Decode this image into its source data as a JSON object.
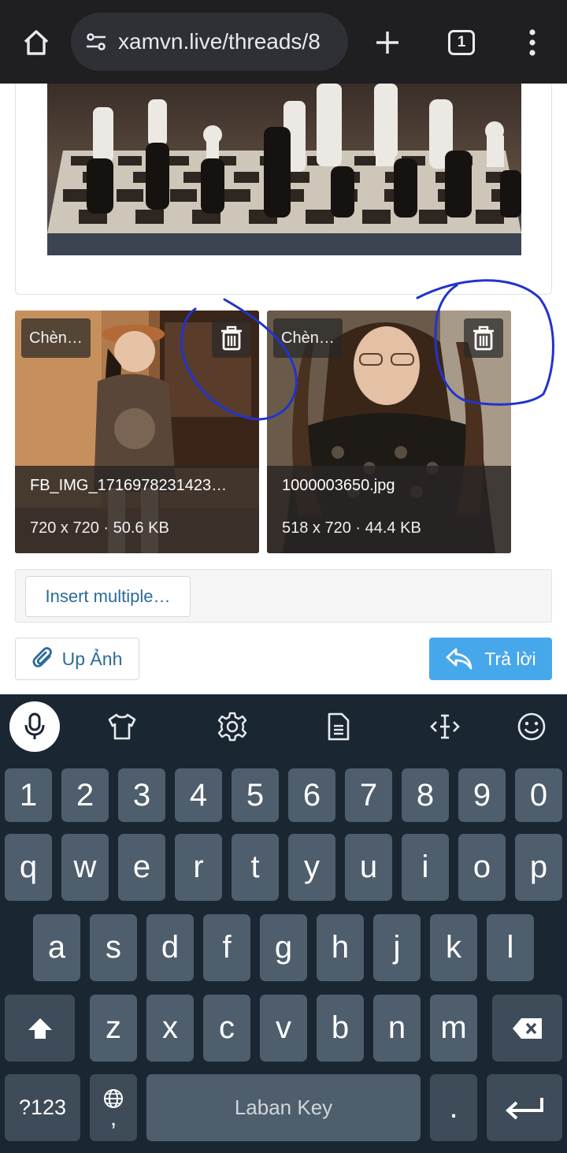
{
  "browser": {
    "url": "xamvn.live/threads/8",
    "tab_count": "1",
    "icons": [
      "home-icon",
      "site-settings-icon",
      "new-tab-plus-icon",
      "tab-switcher-icon",
      "more-vert-icon"
    ]
  },
  "attachments": [
    {
      "insert_label": "Chèn…",
      "filename": "FB_IMG_1716978231423…",
      "meta": "720 x 720 · 50.6 KB"
    },
    {
      "insert_label": "Chèn…",
      "filename": "1000003650.jpg",
      "meta": "518 x 720 · 44.4 KB"
    }
  ],
  "editor": {
    "insert_multiple_label": "Insert multiple…",
    "upload_label": "Up Ảnh",
    "reply_label": "Trả lời"
  },
  "colors": {
    "accent": "#47a7eb",
    "link": "#2a6b98",
    "annotation_circle": "#2233cc",
    "keyboard_bg": "#1b2633",
    "key_bg": "#4f5e6c"
  },
  "keyboard": {
    "toolbar_icons": [
      "mic-icon",
      "theme-shirt-icon",
      "settings-gear-icon",
      "clipboard-icon",
      "cursor-move-icon",
      "emoji-icon"
    ],
    "row_numbers": [
      "1",
      "2",
      "3",
      "4",
      "5",
      "6",
      "7",
      "8",
      "9",
      "0"
    ],
    "row_top": [
      "q",
      "w",
      "e",
      "r",
      "t",
      "y",
      "u",
      "i",
      "o",
      "p"
    ],
    "row_middle": [
      "a",
      "s",
      "d",
      "f",
      "g",
      "h",
      "j",
      "k",
      "l"
    ],
    "row_bottom": [
      "z",
      "x",
      "c",
      "v",
      "b",
      "n",
      "m"
    ],
    "symbols_label": "?123",
    "comma_label": ",",
    "space_label": "Laban Key",
    "period_label": "."
  }
}
